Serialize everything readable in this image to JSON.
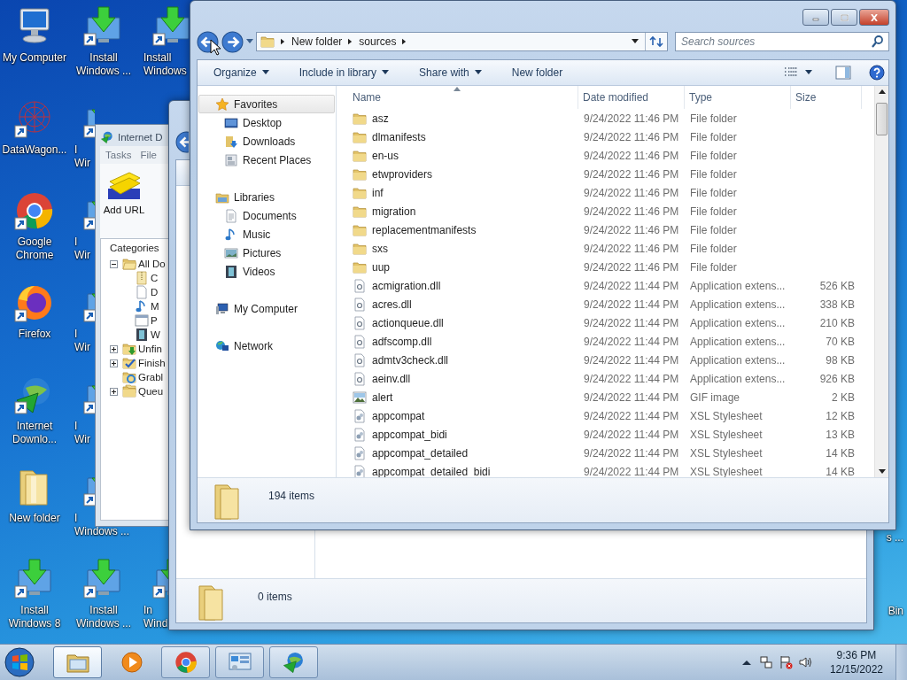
{
  "desktop": {
    "icon_columns": [
      [
        {
          "kind": "computer",
          "lines": [
            "My Computer"
          ],
          "shortcut": false,
          "cut": false
        },
        {
          "kind": "dataweb",
          "lines": [
            "DataWagon..."
          ],
          "shortcut": true,
          "cut": false
        },
        {
          "kind": "chrome",
          "lines": [
            "Google",
            "Chrome"
          ],
          "shortcut": true,
          "cut": false
        },
        {
          "kind": "firefox",
          "lines": [
            "Firefox"
          ],
          "shortcut": true,
          "cut": false
        },
        {
          "kind": "idm",
          "lines": [
            "Internet",
            "Downlo..."
          ],
          "shortcut": true,
          "cut": false
        },
        {
          "kind": "folder",
          "lines": [
            "New folder"
          ],
          "shortcut": false,
          "cut": false
        },
        {
          "kind": "install",
          "lines": [
            "Install",
            "Windows 8"
          ],
          "shortcut": true,
          "cut": false
        }
      ],
      [
        {
          "kind": "install",
          "lines": [
            "Install",
            "Windows ..."
          ],
          "shortcut": true,
          "cut": false
        },
        {
          "kind": "install",
          "lines": [
            "I",
            "Wir"
          ],
          "shortcut": true,
          "cut": true
        },
        {
          "kind": "install",
          "lines": [
            "I",
            "Wir"
          ],
          "shortcut": true,
          "cut": true
        },
        {
          "kind": "install",
          "lines": [
            "I",
            "Wir"
          ],
          "shortcut": true,
          "cut": true
        },
        {
          "kind": "install",
          "lines": [
            "I",
            "Wir"
          ],
          "shortcut": true,
          "cut": true
        },
        {
          "kind": "install",
          "lines": [
            "I",
            "Windows ..."
          ],
          "shortcut": true,
          "cut": true
        },
        {
          "kind": "install",
          "lines": [
            "Install",
            "Windows ..."
          ],
          "shortcut": true,
          "cut": false
        }
      ],
      [
        {
          "kind": "install",
          "lines": [
            "Install",
            "Windows"
          ],
          "shortcut": true,
          "cut": true
        },
        {
          "kind": "install",
          "lines": [
            "In",
            "Wind"
          ],
          "shortcut": true,
          "cut": true
        }
      ]
    ],
    "right_edge_labels": [
      "s ...",
      "Bin"
    ]
  },
  "idm_window": {
    "title": "Internet D",
    "menu": [
      "Tasks",
      "File"
    ],
    "add_url": "Add URL",
    "categories_label": "Categories",
    "tree": [
      {
        "label": "All Do",
        "kind": "folder-open",
        "expanded": true,
        "children": [
          {
            "label": "C",
            "kind": "zip"
          },
          {
            "label": "D",
            "kind": "doc"
          },
          {
            "label": "M",
            "kind": "music"
          },
          {
            "label": "P",
            "kind": "program"
          },
          {
            "label": "W",
            "kind": "video"
          }
        ]
      },
      {
        "label": "Unfin",
        "kind": "unfinished",
        "expanded": false
      },
      {
        "label": "Finish",
        "kind": "finished",
        "expanded": false
      },
      {
        "label": "Grabl",
        "kind": "grabber"
      },
      {
        "label": "Queu",
        "kind": "queues",
        "expanded": false
      }
    ]
  },
  "back_window": {
    "status": "0 items"
  },
  "explorer": {
    "breadcrumb": [
      "New folder",
      "sources"
    ],
    "search_placeholder": "Search sources",
    "toolbar": [
      {
        "label": "Organize",
        "dropdown": true
      },
      {
        "label": "Include in library",
        "dropdown": true
      },
      {
        "label": "Share with",
        "dropdown": true
      },
      {
        "label": "New folder",
        "dropdown": false
      }
    ],
    "nav": [
      {
        "label": "Favorites",
        "kind": "star",
        "highlighted": true,
        "children": [
          {
            "label": "Desktop",
            "kind": "desktop"
          },
          {
            "label": "Downloads",
            "kind": "downloads"
          },
          {
            "label": "Recent Places",
            "kind": "recent"
          }
        ]
      },
      {
        "label": "Libraries",
        "kind": "libraries",
        "highlighted": false,
        "children": [
          {
            "label": "Documents",
            "kind": "documents"
          },
          {
            "label": "Music",
            "kind": "music"
          },
          {
            "label": "Pictures",
            "kind": "pictures"
          },
          {
            "label": "Videos",
            "kind": "videos"
          }
        ]
      },
      {
        "label": "My Computer",
        "kind": "computer",
        "highlighted": false
      },
      {
        "label": "Network",
        "kind": "network",
        "highlighted": false
      }
    ],
    "columns": [
      {
        "label": "Name",
        "sorted": true
      },
      {
        "label": "Date modified",
        "sorted": false
      },
      {
        "label": "Type",
        "sorted": false
      },
      {
        "label": "Size",
        "sorted": false
      }
    ],
    "files": [
      {
        "name": "asz",
        "kind": "folder",
        "date": "9/24/2022 11:46 PM",
        "type": "File folder"
      },
      {
        "name": "dlmanifests",
        "kind": "folder",
        "date": "9/24/2022 11:46 PM",
        "type": "File folder"
      },
      {
        "name": "en-us",
        "kind": "folder",
        "date": "9/24/2022 11:46 PM",
        "type": "File folder"
      },
      {
        "name": "etwproviders",
        "kind": "folder",
        "date": "9/24/2022 11:46 PM",
        "type": "File folder"
      },
      {
        "name": "inf",
        "kind": "folder",
        "date": "9/24/2022 11:46 PM",
        "type": "File folder"
      },
      {
        "name": "migration",
        "kind": "folder",
        "date": "9/24/2022 11:46 PM",
        "type": "File folder"
      },
      {
        "name": "replacementmanifests",
        "kind": "folder",
        "date": "9/24/2022 11:46 PM",
        "type": "File folder"
      },
      {
        "name": "sxs",
        "kind": "folder",
        "date": "9/24/2022 11:46 PM",
        "type": "File folder"
      },
      {
        "name": "uup",
        "kind": "folder",
        "date": "9/24/2022 11:46 PM",
        "type": "File folder"
      },
      {
        "name": "acmigration.dll",
        "kind": "dll",
        "date": "9/24/2022 11:44 PM",
        "type": "Application extens...",
        "size": "526 KB"
      },
      {
        "name": "acres.dll",
        "kind": "dll",
        "date": "9/24/2022 11:44 PM",
        "type": "Application extens...",
        "size": "338 KB"
      },
      {
        "name": "actionqueue.dll",
        "kind": "dll",
        "date": "9/24/2022 11:44 PM",
        "type": "Application extens...",
        "size": "210 KB"
      },
      {
        "name": "adfscomp.dll",
        "kind": "dll",
        "date": "9/24/2022 11:44 PM",
        "type": "Application extens...",
        "size": "70 KB"
      },
      {
        "name": "admtv3check.dll",
        "kind": "dll",
        "date": "9/24/2022 11:44 PM",
        "type": "Application extens...",
        "size": "98 KB"
      },
      {
        "name": "aeinv.dll",
        "kind": "dll",
        "date": "9/24/2022 11:44 PM",
        "type": "Application extens...",
        "size": "926 KB"
      },
      {
        "name": "alert",
        "kind": "gif",
        "date": "9/24/2022 11:44 PM",
        "type": "GIF image",
        "size": "2 KB"
      },
      {
        "name": "appcompat",
        "kind": "xsl",
        "date": "9/24/2022 11:44 PM",
        "type": "XSL Stylesheet",
        "size": "12 KB"
      },
      {
        "name": "appcompat_bidi",
        "kind": "xsl",
        "date": "9/24/2022 11:44 PM",
        "type": "XSL Stylesheet",
        "size": "13 KB"
      },
      {
        "name": "appcompat_detailed",
        "kind": "xsl",
        "date": "9/24/2022 11:44 PM",
        "type": "XSL Stylesheet",
        "size": "14 KB"
      },
      {
        "name": "appcompat_detailed_bidi",
        "kind": "xsl",
        "date": "9/24/2022 11:44 PM",
        "type": "XSL Stylesheet",
        "size": "14 KB"
      }
    ],
    "status": "194 items"
  },
  "taskbar": {
    "items": [
      {
        "kind": "explorer",
        "running": true,
        "active": true
      },
      {
        "kind": "media",
        "running": false,
        "active": false
      },
      {
        "kind": "chrome",
        "running": true,
        "active": false
      },
      {
        "kind": "control",
        "running": true,
        "active": false
      },
      {
        "kind": "idm",
        "running": true,
        "active": false
      }
    ],
    "time": "9:36 PM",
    "date": "12/15/2022"
  }
}
